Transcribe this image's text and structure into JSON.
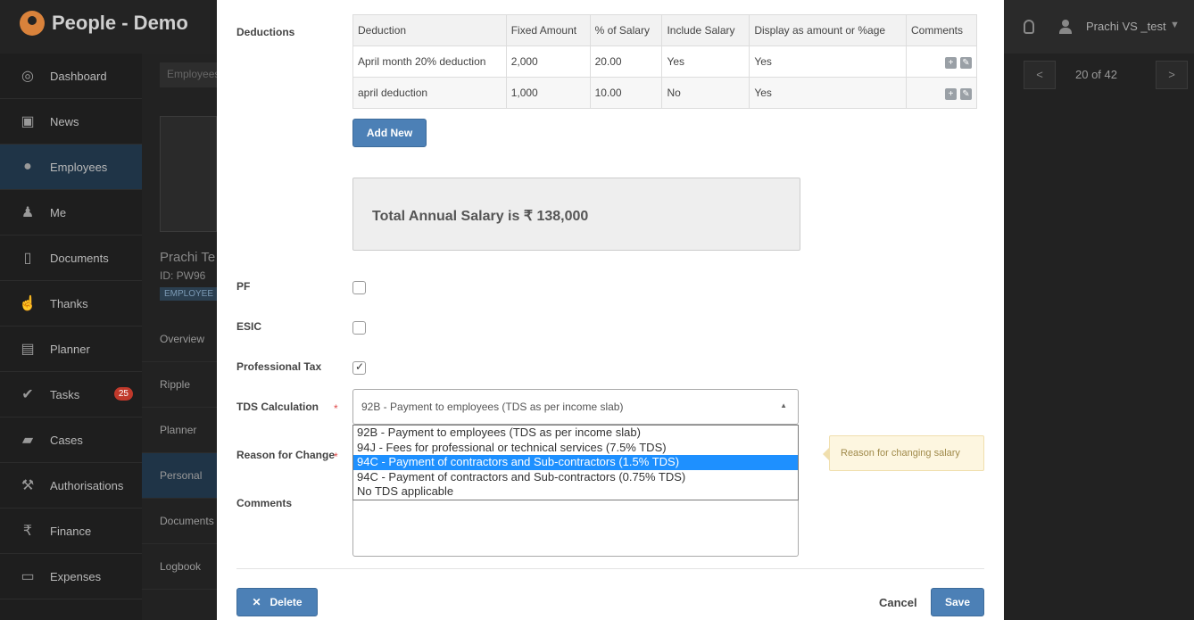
{
  "app": {
    "title": "People - Demo"
  },
  "user": {
    "name": "Prachi VS _test"
  },
  "sidebar": {
    "items": [
      {
        "label": "Dashboard",
        "icon": "dashboard-icon"
      },
      {
        "label": "News",
        "icon": "tv-icon"
      },
      {
        "label": "Employees",
        "icon": "users-icon"
      },
      {
        "label": "Me",
        "icon": "user-star-icon"
      },
      {
        "label": "Documents",
        "icon": "document-icon"
      },
      {
        "label": "Thanks",
        "icon": "thumbs-up-icon"
      },
      {
        "label": "Planner",
        "icon": "planner-icon"
      },
      {
        "label": "Tasks",
        "icon": "check-icon",
        "badge": "25"
      },
      {
        "label": "Cases",
        "icon": "briefcase-icon"
      },
      {
        "label": "Authorisations",
        "icon": "gavel-icon"
      },
      {
        "label": "Finance",
        "icon": "rupee-icon"
      },
      {
        "label": "Expenses",
        "icon": "wallet-icon"
      }
    ]
  },
  "profile": {
    "breadcrumb": "Employees",
    "name": "Prachi Te",
    "id": "ID: PW96",
    "badge": "EMPLOYEE",
    "nav": [
      "Overview",
      "Ripple",
      "Planner",
      "Personal",
      "Documents",
      "Logbook"
    ]
  },
  "pager": {
    "prev": "<",
    "text": "20 of 42",
    "next": ">"
  },
  "form": {
    "deductions_label": "Deductions",
    "table": {
      "headers": [
        "Deduction",
        "Fixed Amount",
        "% of Salary",
        "Include Salary",
        "Display as amount or %age",
        "Comments"
      ],
      "rows": [
        [
          "April month 20% deduction",
          "2,000",
          "20.00",
          "Yes",
          "Yes"
        ],
        [
          "april deduction",
          "1,000",
          "10.00",
          "No",
          "Yes"
        ]
      ],
      "comment_add": "+",
      "comment_edit": "✎"
    },
    "add_new": "Add New",
    "total": "Total Annual Salary is ₹ 138,000",
    "pf_label": "PF",
    "esic_label": "ESIC",
    "ptax_label": "Professional Tax",
    "tds_label": "TDS Calculation",
    "required_mark": "*",
    "tds_selected": "92B - Payment to employees (TDS as per income slab)",
    "tds_options": [
      "92B - Payment to employees (TDS as per income slab)",
      "94J - Fees for professional or technical services (7.5% TDS)",
      "94C - Payment of contractors and Sub-contractors (1.5% TDS)",
      "94C - Payment of contractors and Sub-contractors (0.75% TDS)",
      "No TDS applicable"
    ],
    "reason_label": "Reason for Change",
    "reason_tooltip": "Reason for changing salary",
    "comments_label": "Comments",
    "delete": "Delete",
    "cancel": "Cancel",
    "save": "Save"
  }
}
